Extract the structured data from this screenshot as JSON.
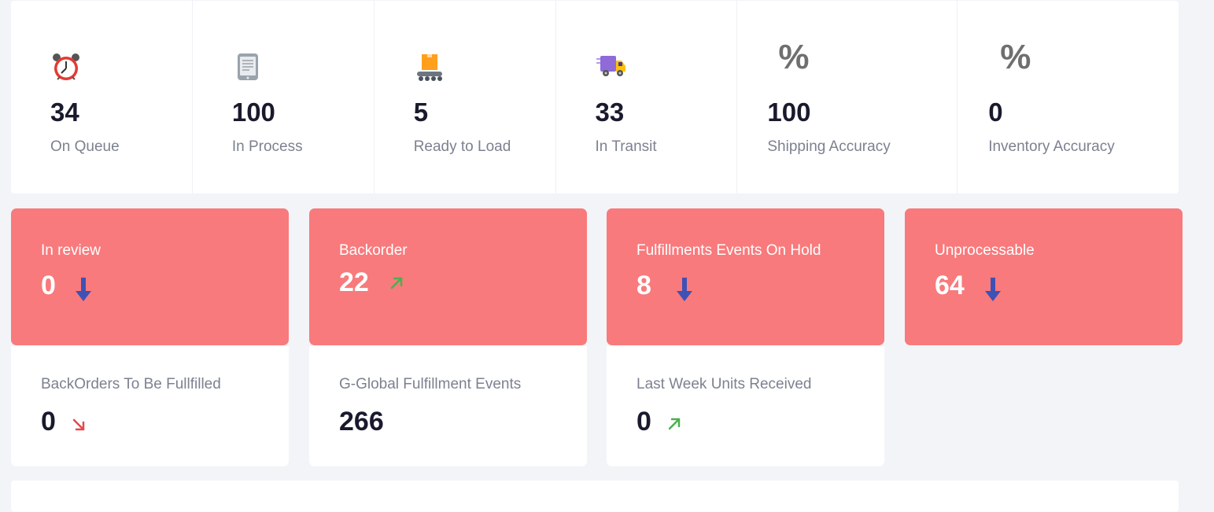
{
  "stats": [
    {
      "value": "34",
      "label": "On Queue",
      "icon": "alarm-clock-icon"
    },
    {
      "value": "100",
      "label": "In Process",
      "icon": "document-icon"
    },
    {
      "value": "5",
      "label": "Ready to Load",
      "icon": "conveyor-box-icon"
    },
    {
      "value": "33",
      "label": "In Transit",
      "icon": "truck-icon"
    },
    {
      "value": "100",
      "label": "Shipping Accuracy",
      "icon": "percent-icon",
      "symbol": "%"
    },
    {
      "value": "0",
      "label": "Inventory Accuracy",
      "icon": "percent-icon",
      "symbol": "%"
    }
  ],
  "alert_cards": [
    {
      "title": "In review",
      "value": "0",
      "trend": "down",
      "trend_icon": "arrow-down-icon"
    },
    {
      "title": "Backorder",
      "value": "22",
      "trend": "up-right",
      "trend_icon": "arrow-up-right-icon"
    },
    {
      "title": "Fulfillments Events On Hold",
      "value": "8",
      "trend": "down",
      "trend_icon": "arrow-down-icon"
    },
    {
      "title": "Unprocessable",
      "value": "64",
      "trend": "down",
      "trend_icon": "arrow-down-icon"
    }
  ],
  "info_cards": [
    {
      "title": "BackOrders To Be Fullfilled",
      "value": "0",
      "trend": "down-right",
      "trend_icon": "arrow-down-right-icon"
    },
    {
      "title": "G-Global Fulfillment Events",
      "value": "266"
    },
    {
      "title": "Last Week Units Received",
      "value": "0",
      "trend": "up-right",
      "trend_icon": "arrow-up-right-icon"
    }
  ],
  "colors": {
    "alert_card_bg": "#f87a7c",
    "arrow_down": "#3f51b5",
    "arrow_up_right": "#4caf50",
    "arrow_down_right": "#e5484d"
  }
}
